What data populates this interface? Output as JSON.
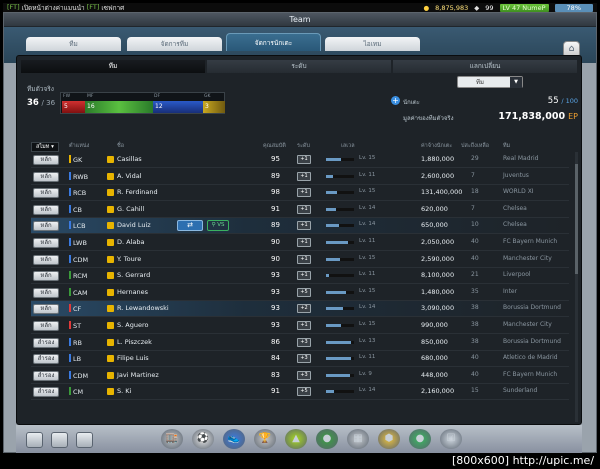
{
  "topbar": {
    "news_tag": "[FT]",
    "news_text": "เปิดหน้าต่างค่าแมนนำ",
    "news_tag2": "[FT]",
    "news_text2": "เซฟกาศ",
    "gold": "8,875,983",
    "coin": "99",
    "level": "LV 47 NumeP",
    "battery": "78%"
  },
  "window": {
    "title": "Team",
    "tabs": [
      "ทีม",
      "จัดการทีม",
      "จัดการนักเตะ",
      "ไอเทม"
    ],
    "active_tab": 2,
    "home_icon": "home-icon"
  },
  "subtabs": [
    "ทีม",
    "ระดับ",
    "แลกเปลี่ยน"
  ],
  "summary": {
    "label": "ทีมตัวจริง",
    "count": "36",
    "total": "/ 36",
    "lines": {
      "fw": "FW",
      "mf": "MF",
      "df": "DF",
      "gk": "GK"
    },
    "line_counts": {
      "fw": "5",
      "mf": "16",
      "df": "12",
      "gk": "3"
    }
  },
  "dropdown": {
    "value": "ทีม",
    "arrow": "▼"
  },
  "stats": {
    "players_label": "นักเตะ",
    "players_count": "55",
    "players_max": "/ 100",
    "value_label": "มูลค่าของทีมตัวจริง",
    "value": "171,838,000",
    "value_unit": "EP"
  },
  "table_headers": {
    "sort": "สไมท ▾",
    "position": "ตำแหน่ง",
    "name": "ชื่อ",
    "ovr": "คุณสมบัติ",
    "fitness": "ระดับ",
    "level": "เลเวล",
    "salary": "ค่าจ้างนักเตะ",
    "age": "ปสะถึงเหลือ",
    "club": "ทีม"
  },
  "players": [
    {
      "btn": "หลัก",
      "pos": "GK",
      "color": "#e8b400",
      "name": "Casillas",
      "ovr": "95",
      "fit": "+1",
      "lvfrac": 0.55,
      "lv": "Lv. 15",
      "salary": "1,880,000",
      "age": "29",
      "club": "Real Madrid"
    },
    {
      "btn": "หลัก",
      "pos": "RWB",
      "color": "#3a7ae0",
      "name": "A. Vidal",
      "ovr": "89",
      "fit": "+1",
      "lvfrac": 0.25,
      "lv": "Lv. 11",
      "salary": "2,600,000",
      "age": "7",
      "club": "Juventus"
    },
    {
      "btn": "หลัก",
      "pos": "RCB",
      "color": "#3a7ae0",
      "name": "R. Ferdinand",
      "ovr": "98",
      "fit": "+1",
      "lvfrac": 0.4,
      "lv": "Lv. 15",
      "salary": "131,400,000",
      "age": "18",
      "club": "WORLD XI"
    },
    {
      "btn": "หลัก",
      "pos": "CB",
      "color": "#3a7ae0",
      "name": "G. Cahill",
      "ovr": "91",
      "fit": "+1",
      "lvfrac": 0.35,
      "lv": "Lv. 14",
      "salary": "620,000",
      "age": "7",
      "club": "Chelsea"
    },
    {
      "btn": "หลัก",
      "pos": "LCB",
      "color": "#3a7ae0",
      "name": "David Luiz",
      "ovr": "89",
      "fit": "+1",
      "lvfrac": 0.45,
      "lv": "Lv. 14",
      "salary": "650,000",
      "age": "10",
      "club": "Chelsea",
      "highlight": true,
      "skill_icon": "⇄",
      "vs_label": "VS"
    },
    {
      "btn": "หลัก",
      "pos": "LWB",
      "color": "#3a7ae0",
      "name": "D. Alaba",
      "ovr": "90",
      "fit": "+1",
      "lvfrac": 0.8,
      "lv": "Lv. 11",
      "salary": "2,050,000",
      "age": "40",
      "club": "FC Bayern Munich"
    },
    {
      "btn": "หลัก",
      "pos": "CDM",
      "color": "#3a7ae0",
      "name": "Y. Toure",
      "ovr": "90",
      "fit": "+1",
      "lvfrac": 0.5,
      "lv": "Lv. 15",
      "salary": "2,590,000",
      "age": "40",
      "club": "Manchester City"
    },
    {
      "btn": "หลัก",
      "pos": "RCM",
      "color": "#3a9a3a",
      "name": "S. Gerrard",
      "ovr": "93",
      "fit": "+1",
      "lvfrac": 0.1,
      "lv": "Lv. 11",
      "salary": "8,100,000",
      "age": "21",
      "club": "Liverpool"
    },
    {
      "btn": "หลัก",
      "pos": "CAM",
      "color": "#3a9a3a",
      "name": "Hernanes",
      "ovr": "93",
      "fit": "+5",
      "lvfrac": 0.7,
      "lv": "Lv. 15",
      "salary": "1,480,000",
      "age": "35",
      "club": "Inter"
    },
    {
      "btn": "หลัก",
      "pos": "CF",
      "color": "#e03a3a",
      "name": "R. Lewandowski",
      "ovr": "93",
      "fit": "+2",
      "lvfrac": 0.6,
      "lv": "Lv. 14",
      "salary": "3,090,000",
      "age": "38",
      "club": "Borussia Dortmund",
      "highlight": true
    },
    {
      "btn": "หลัก",
      "pos": "ST",
      "color": "#e03a3a",
      "name": "S. Aguero",
      "ovr": "93",
      "fit": "+1",
      "lvfrac": 0.55,
      "lv": "Lv. 15",
      "salary": "990,000",
      "age": "38",
      "club": "Manchester City"
    },
    {
      "btn": "สำรอง",
      "pos": "RB",
      "color": "#3a7ae0",
      "name": "L. Piszczek",
      "ovr": "86",
      "fit": "+3",
      "lvfrac": 0.9,
      "lv": "Lv. 13",
      "salary": "850,000",
      "age": "38",
      "club": "Borussia Dortmund"
    },
    {
      "btn": "สำรอง",
      "pos": "LB",
      "color": "#3a7ae0",
      "name": "Filipe Luis",
      "ovr": "84",
      "fit": "+3",
      "lvfrac": 0.9,
      "lv": "Lv. 11",
      "salary": "680,000",
      "age": "40",
      "club": "Atletico de Madrid"
    },
    {
      "btn": "สำรอง",
      "pos": "CDM",
      "color": "#3a7ae0",
      "name": "Javi Martinez",
      "ovr": "83",
      "fit": "+3",
      "lvfrac": 0.85,
      "lv": "Lv. 9",
      "salary": "448,000",
      "age": "40",
      "club": "FC Bayern Munich"
    },
    {
      "btn": "สำรอง",
      "pos": "CM",
      "color": "#3a9a3a",
      "name": "S. Ki",
      "ovr": "91",
      "fit": "+5",
      "lvfrac": 0.3,
      "lv": "Lv. 14",
      "salary": "2,160,000",
      "age": "15",
      "club": "Sunderland"
    }
  ],
  "bottom": {
    "left_buttons": [
      "chat-icon",
      "list-icon",
      "mail-icon"
    ],
    "dock": [
      {
        "name": "shop-icon",
        "glyph": "🏬"
      },
      {
        "name": "ball-icon",
        "glyph": "⚽"
      },
      {
        "name": "boot-icon",
        "glyph": "👟"
      },
      {
        "name": "trophy-icon",
        "glyph": "🏆"
      },
      {
        "name": "cone-icon",
        "glyph": "▲"
      },
      {
        "name": "league-icon",
        "glyph": "●"
      },
      {
        "name": "cards-icon",
        "glyph": "▦"
      },
      {
        "name": "medal-icon",
        "glyph": "⬢"
      },
      {
        "name": "club-icon",
        "glyph": "●"
      },
      {
        "name": "check-icon",
        "glyph": "☑"
      }
    ]
  },
  "watermark": "[800x600] http://upic.me/"
}
